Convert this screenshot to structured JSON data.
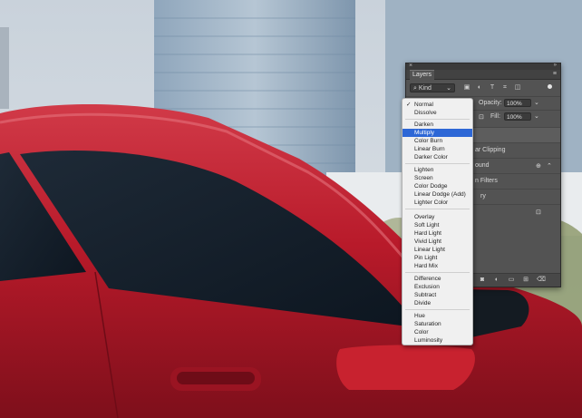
{
  "panel": {
    "tab": "Layers",
    "kind_filter": "Kind",
    "opacity_label": "Opacity:",
    "opacity_value": "100%",
    "fill_label": "Fill:",
    "fill_value": "100%",
    "layer_partial_1": "ar Clipping",
    "layer_partial_2": "ound",
    "layer_partial_3": "n Filters",
    "layer_partial_4": "ry"
  },
  "blend_menu": {
    "selected": "Multiply",
    "checked": "Normal",
    "items": [
      "Normal",
      "Dissolve",
      "Darken",
      "Multiply",
      "Color Burn",
      "Linear Burn",
      "Darker Color",
      "Lighten",
      "Screen",
      "Color Dodge",
      "Linear Dodge (Add)",
      "Lighter Color",
      "Overlay",
      "Soft Light",
      "Hard Light",
      "Vivid Light",
      "Linear Light",
      "Pin Light",
      "Hard Mix",
      "Difference",
      "Exclusion",
      "Subtract",
      "Divide",
      "Hue",
      "Saturation",
      "Color",
      "Luminosity"
    ]
  },
  "icons": [
    "search-icon",
    "image-filter-icon",
    "adjustment-filter-icon",
    "type-filter-icon",
    "shape-filter-icon",
    "smart-object-filter-icon",
    "filter-toggle-icon",
    "lock-icon",
    "link-icon",
    "fx-icon",
    "mask-icon",
    "adjustment-layer-icon",
    "group-icon",
    "new-layer-icon",
    "trash-icon"
  ],
  "colors": {
    "car": "#c01f2e",
    "panel": "#535353",
    "menu_highlight": "#2d67d6"
  }
}
